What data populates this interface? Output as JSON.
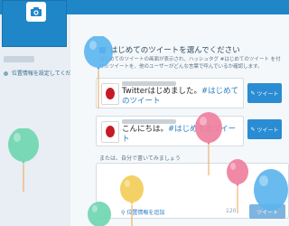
{
  "sidebar": {
    "link_label": "位置情報を設定してください"
  },
  "header": {
    "title": "はじめてのツイートを選んでください"
  },
  "description": "はじめてのツイートの画面が表示され、ハッシュタグ #はじめてのツイート を付けたツイートを、他のユーザーがどんな言葉で呼んでいるか確認します。",
  "tweets": [
    {
      "text": "Twitterはじめました。",
      "hashtag": "#はじめてのツイート",
      "button_label": "ツイート"
    },
    {
      "text": "こんにちは。",
      "hashtag": "#はじめてのツイート",
      "button_label": "ツイート"
    }
  ],
  "compose": {
    "label": "または、自分で書いてみましょう",
    "location": "位置情報を追加",
    "counter": "120",
    "send_label": "ツイート"
  },
  "colors": {
    "brand_blue": "#1f86c8",
    "button_blue": "#2a8cd3",
    "balloon_blue": "#5bb4ee",
    "balloon_pink": "#ef7f9e",
    "balloon_green": "#6fd6b0",
    "balloon_yellow": "#f3cf5e"
  }
}
